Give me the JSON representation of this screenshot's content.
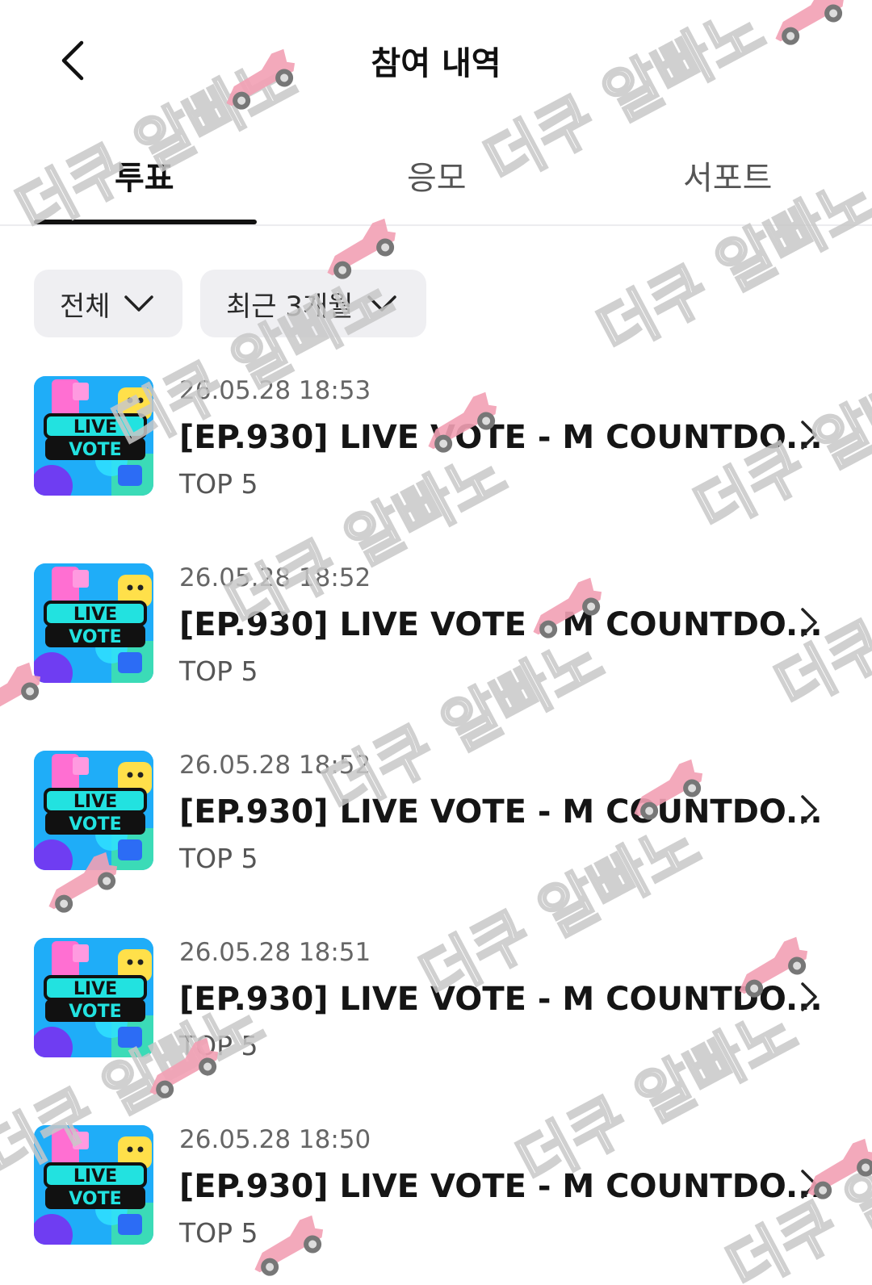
{
  "header": {
    "title": "참여 내역",
    "back_icon": "chevron-left-icon"
  },
  "tabs": [
    {
      "label": "투표",
      "active": true
    },
    {
      "label": "응모",
      "active": false
    },
    {
      "label": "서포트",
      "active": false
    }
  ],
  "filters": [
    {
      "label": "전체",
      "icon": "chevron-down-icon"
    },
    {
      "label": "최근 3개월",
      "icon": "chevron-down-icon"
    }
  ],
  "list": {
    "items": [
      {
        "date": "26.05.28 18:53",
        "title": "[EP.930] LIVE VOTE - M COUNTDO...",
        "subtitle": "TOP 5",
        "thumbnail_text": [
          "LIVE",
          "VOTE"
        ]
      },
      {
        "date": "26.05.28 18:52",
        "title": "[EP.930] LIVE VOTE - M COUNTDO...",
        "subtitle": "TOP 5",
        "thumbnail_text": [
          "LIVE",
          "VOTE"
        ]
      },
      {
        "date": "26.05.28 18:52",
        "title": "[EP.930] LIVE VOTE - M COUNTDO...",
        "subtitle": "TOP 5",
        "thumbnail_text": [
          "LIVE",
          "VOTE"
        ]
      },
      {
        "date": "26.05.28 18:51",
        "title": "[EP.930] LIVE VOTE - M COUNTDO...",
        "subtitle": "TOP 5",
        "thumbnail_text": [
          "LIVE",
          "VOTE"
        ]
      },
      {
        "date": "26.05.28 18:50",
        "title": "[EP.930] LIVE VOTE - M COUNTDO...",
        "subtitle": "TOP 5",
        "thumbnail_text": [
          "LIVE",
          "VOTE"
        ]
      }
    ]
  },
  "watermark": {
    "text": "더쿠 알빠노",
    "color": "#c8c8c8",
    "car_color": "#f2a0b4"
  },
  "colors": {
    "text_primary": "#111111",
    "text_secondary": "#666666",
    "filter_bg": "#efeff2",
    "tab_indicator": "#111111"
  }
}
